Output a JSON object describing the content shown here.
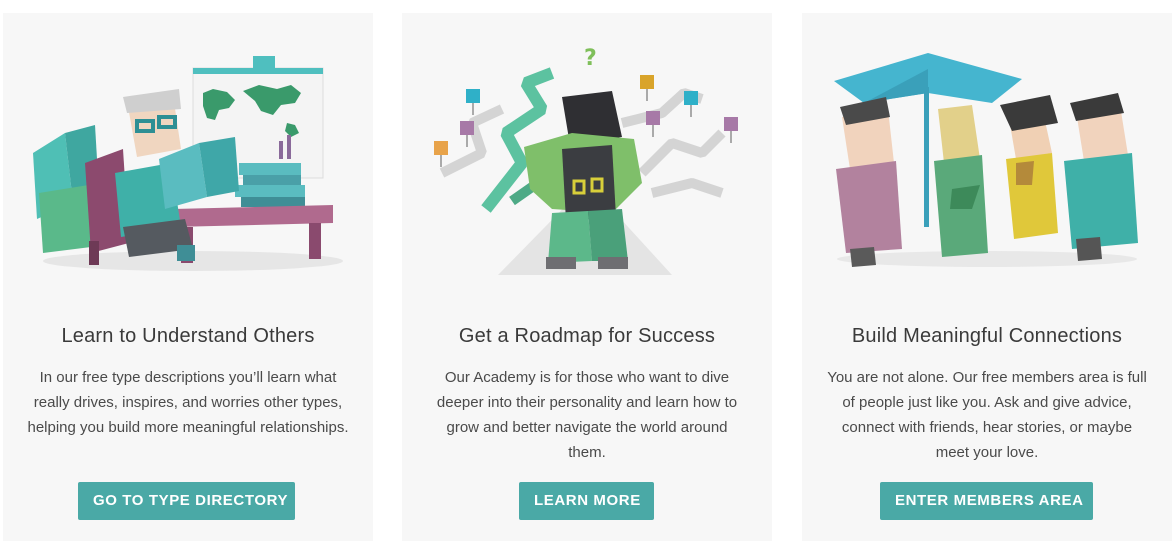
{
  "cards": [
    {
      "title": "Learn to Understand Others",
      "body": "In our free type descriptions you’ll learn what really drives, inspires, and worries other types, helping you build more meaningful relationships.",
      "button": "GO TO TYPE DIRECTORY",
      "illustration": "scholar-reading-illustration"
    },
    {
      "title": "Get a Roadmap for Success",
      "body": "Our Academy is for those who want to dive deeper into their personality and learn how to grow and better navigate the world around them.",
      "button": "LEARN MORE",
      "illustration": "explorer-roadmap-illustration"
    },
    {
      "title": "Build Meaningful Connections",
      "body": "You are not alone. Our free members area is full of people just like you. Ask and give advice, connect with friends, hear stories, or maybe meet your love.",
      "button": "ENTER MEMBERS AREA",
      "illustration": "friends-umbrella-illustration"
    }
  ],
  "colors": {
    "card_bg": "#f7f7f7",
    "button_bg": "#4aa9a6",
    "title_text": "#3a3a3a",
    "body_text": "#4a4a4a"
  }
}
